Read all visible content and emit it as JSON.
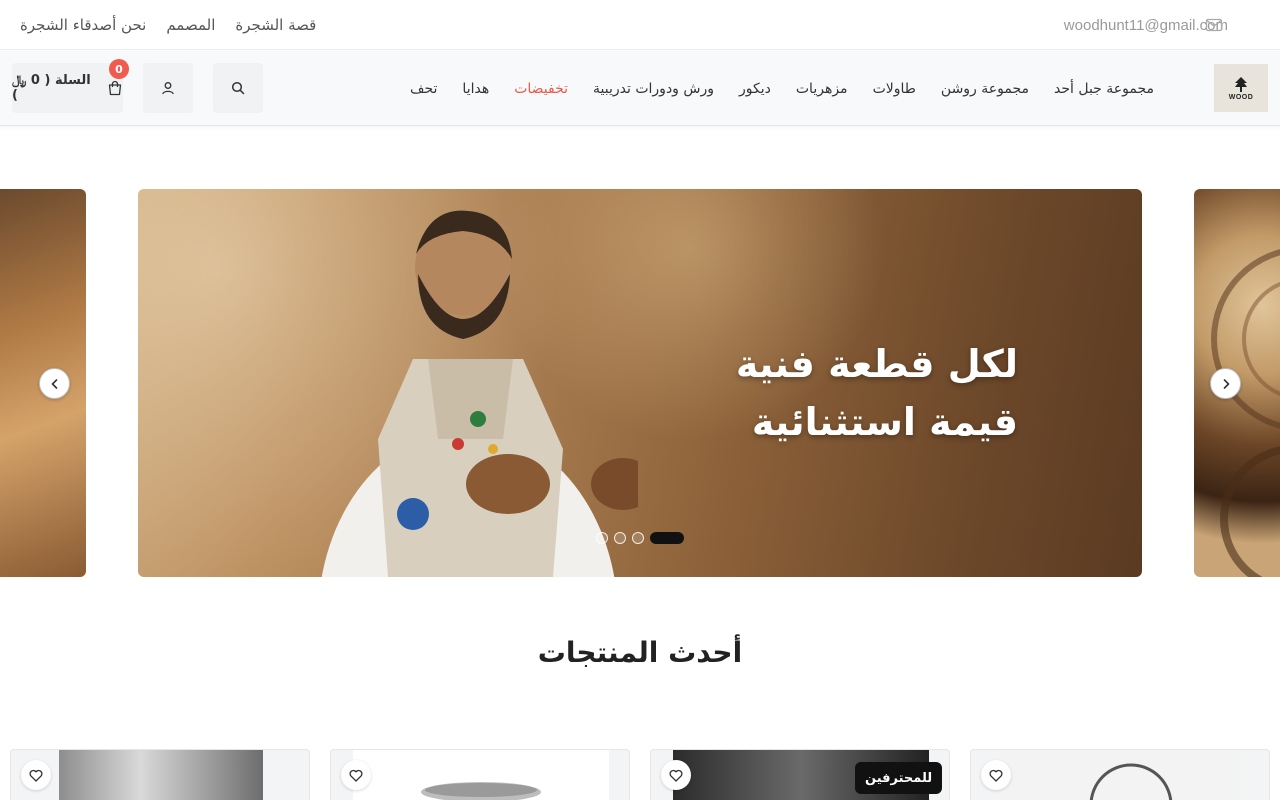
{
  "topbar": {
    "links": [
      "نحن أصدقاء الشجرة",
      "المصمم",
      "قصة الشجرة"
    ],
    "email": "woodhunt11@gmail.com"
  },
  "header": {
    "logo_text": "WOOD",
    "nav": [
      {
        "label": "مجموعة جبل أحد"
      },
      {
        "label": "مجموعة روشن"
      },
      {
        "label": "طاولات"
      },
      {
        "label": "مزهريات"
      },
      {
        "label": "ديكور"
      },
      {
        "label": "ورش ودورات تدريبية"
      },
      {
        "label": "تخفيضات"
      },
      {
        "label": "هدايا"
      },
      {
        "label": "تحف"
      }
    ],
    "cart_label": "السلة ( 0 ﷼ )",
    "cart_count": "0"
  },
  "slider": {
    "headline_line1": "لكل قطعة فنية",
    "headline_line2": "قيمة استثنائية",
    "dot_count": 4,
    "active_dot": 3
  },
  "products_section": {
    "title": "أحدث المنتجات",
    "cards": [
      {
        "badge": ""
      },
      {
        "badge": ""
      },
      {
        "badge": "للمحترفين"
      },
      {
        "badge": ""
      }
    ]
  },
  "colors": {
    "accent_sale": "#e85b4a",
    "cart_badge": "#f05a4f"
  }
}
